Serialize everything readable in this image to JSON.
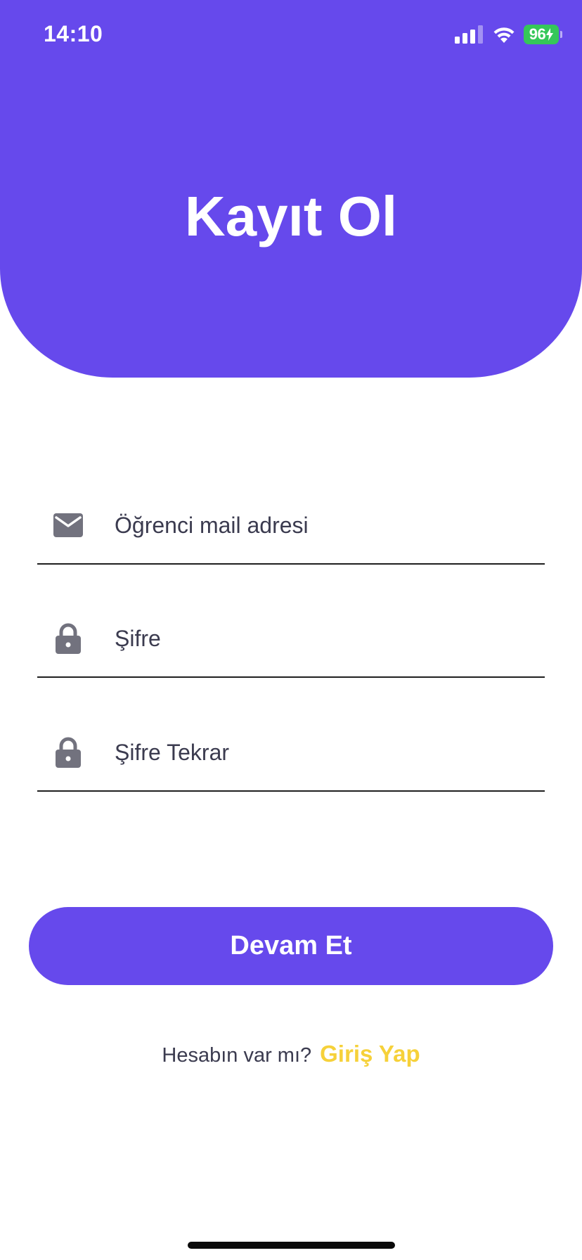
{
  "status_bar": {
    "time": "14:10",
    "battery_percent": "96",
    "signal_icon": "cellular-signal-icon",
    "wifi_icon": "wifi-icon",
    "battery_color": "#35C759"
  },
  "header": {
    "title": "Kayıt Ol",
    "background_color": "#6649EC"
  },
  "form": {
    "email": {
      "placeholder": "Öğrenci mail adresi",
      "value": "",
      "icon": "mail-icon"
    },
    "password": {
      "placeholder": "Şifre",
      "value": "",
      "icon": "lock-icon"
    },
    "password_repeat": {
      "placeholder": "Şifre Tekrar",
      "value": "",
      "icon": "lock-icon"
    }
  },
  "primary_button": {
    "label": "Devam Et",
    "color": "#6649EC"
  },
  "footer": {
    "prompt": "Hesabın var mı?",
    "link_label": "Giriş Yap",
    "link_color": "#F6D13A"
  }
}
